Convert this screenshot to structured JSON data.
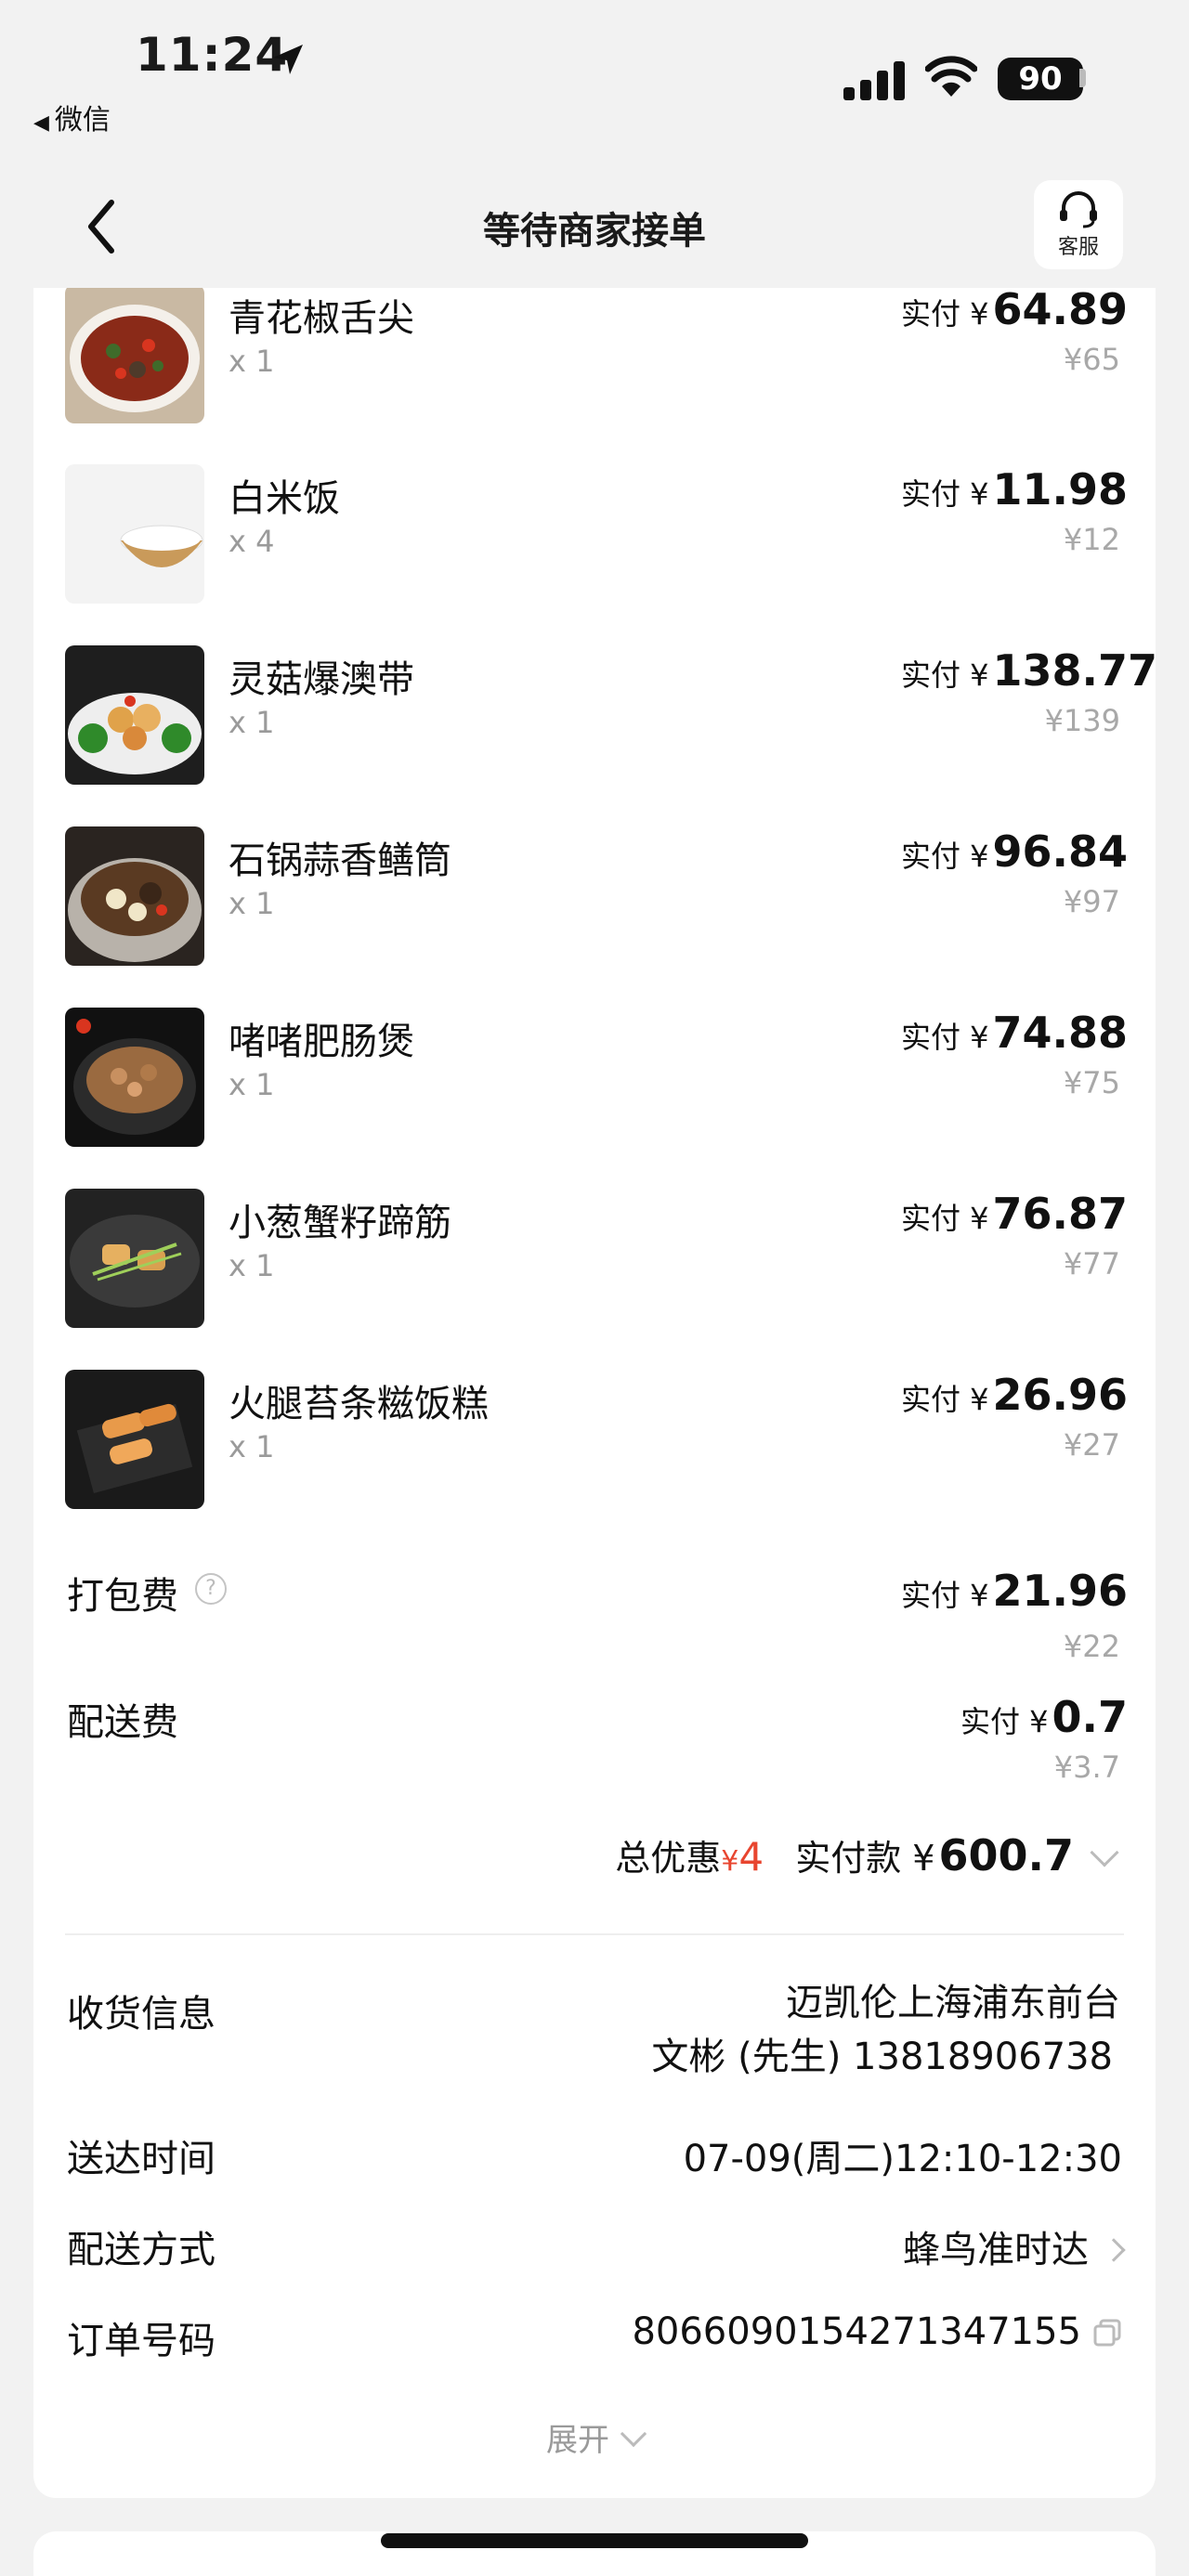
{
  "status_bar": {
    "time": "11:24",
    "back_app": "微信",
    "battery": "90"
  },
  "nav": {
    "title": "等待商家接单",
    "customer_service": "客服"
  },
  "paid_prefix": "实付",
  "currency": "¥",
  "items": [
    {
      "name": "青花椒舌尖",
      "qty": "x 1",
      "paid": "64.89",
      "original": "¥65"
    },
    {
      "name": "白米饭",
      "qty": "x 4",
      "paid": "11.98",
      "original": "¥12"
    },
    {
      "name": "灵菇爆澳带",
      "qty": "x 1",
      "paid": "138.77",
      "original": "¥139"
    },
    {
      "name": "石锅蒜香鳝筒",
      "qty": "x 1",
      "paid": "96.84",
      "original": "¥97"
    },
    {
      "name": "啫啫肥肠煲",
      "qty": "x 1",
      "paid": "74.88",
      "original": "¥75"
    },
    {
      "name": "小葱蟹籽蹄筋",
      "qty": "x 1",
      "paid": "76.87",
      "original": "¥77"
    },
    {
      "name": "火腿苔条糍饭糕",
      "qty": "x 1",
      "paid": "26.96",
      "original": "¥27"
    }
  ],
  "fees": {
    "packing": {
      "label": "打包费",
      "paid": "21.96",
      "original": "¥22"
    },
    "delivery": {
      "label": "配送费",
      "paid": "0.7",
      "original": "¥3.7"
    }
  },
  "totals": {
    "discount_label": "总优惠",
    "discount_symbol": "¥",
    "discount_value": "4",
    "paid_label": "实付款",
    "paid_value": "600.7"
  },
  "info": {
    "address_label": "收货信息",
    "address_line1": "迈凯伦上海浦东前台",
    "address_line2": "文彬 (先生) 13818906738",
    "time_label": "送达时间",
    "time_value": "07-09(周二)12:10-12:30",
    "method_label": "配送方式",
    "method_value": "蜂鸟准时达",
    "order_label": "订单号码",
    "order_value": "8066090154271347155"
  },
  "expand_label": "展开",
  "colors": {
    "discount_red": "#e8452f",
    "muted_gray": "#a8a8a8",
    "page_bg": "#f2f2f2"
  }
}
